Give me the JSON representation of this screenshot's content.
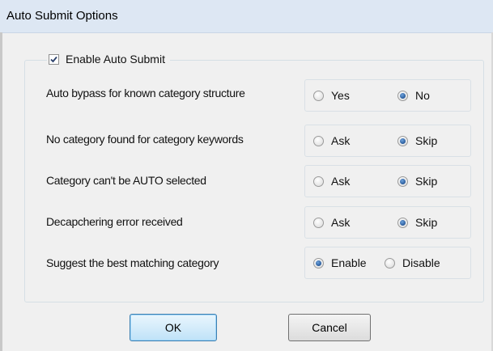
{
  "window": {
    "title": "Auto Submit Options"
  },
  "enable": {
    "label": "Enable Auto Submit",
    "checked": true
  },
  "rows": [
    {
      "label": "Auto bypass for known category structure",
      "option_a": "Yes",
      "option_b": "No",
      "selected": "No"
    },
    {
      "label": "No category found for category keywords",
      "option_a": "Ask",
      "option_b": "Skip",
      "selected": "Skip"
    },
    {
      "label": "Category can't be AUTO selected",
      "option_a": "Ask",
      "option_b": "Skip",
      "selected": "Skip"
    },
    {
      "label": "Decapchering error received",
      "option_a": "Ask",
      "option_b": "Skip",
      "selected": "Skip"
    },
    {
      "label": "Suggest the best matching category",
      "option_a": "Enable",
      "option_b": "Disable",
      "selected": "Enable"
    }
  ],
  "buttons": {
    "ok": "OK",
    "cancel": "Cancel"
  }
}
